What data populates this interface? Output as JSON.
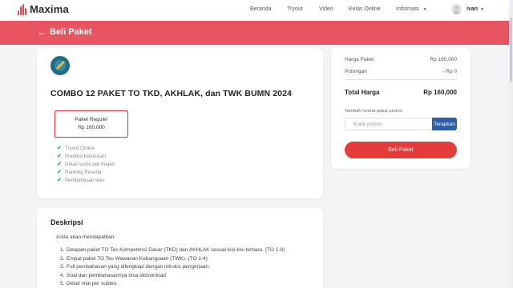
{
  "brand": {
    "name": "Maxima"
  },
  "nav": {
    "links": [
      "Beranda",
      "Tryout",
      "Video",
      "Kelas Online",
      "Informasi"
    ],
    "user_name": "ivan"
  },
  "header": {
    "back_label": "Beli Paket"
  },
  "package": {
    "title": "COMBO 12 PAKET TO TKD, AKHLAK, dan TWK BUMN 2024",
    "variant": {
      "name": "Paket Reguler",
      "price": "Rp 160,000"
    },
    "features": [
      "Tryout Online",
      "Prediksi Kelulusan",
      "Detail score per mapel",
      "Ranking Peserta",
      "Pembahasan teks"
    ]
  },
  "summary": {
    "harga_label": "Harga Paket",
    "harga_value": "Rp 160,000",
    "potongan_label": "Potongan",
    "potongan_value": "- Rp 0",
    "total_label": "Total Harga",
    "total_value": "Rp 160,000",
    "promo_label": "Tambah hemat pakai promo",
    "promo_placeholder": "Kode promo",
    "promo_button": "Terapkan",
    "buy_button": "Beli Paket"
  },
  "description": {
    "title": "Deskripsi",
    "intro": "Anda akan mendapatkan:",
    "items": [
      "Delapan paket TO Tes Kompetensi Dasar (TKD) dan AKHLAK sesuai kisi-kisi terbaru. (TO 1-8)",
      "Empat paket TO Tes Wawasan Kebangsaan (TWK). (TO 1-4)",
      "Full pembahasan yang dilengkapi dengan intruksi pengerjaan.",
      "Soal dan pembahasannya bisa didownload",
      "Detail nilai per subtes."
    ]
  }
}
